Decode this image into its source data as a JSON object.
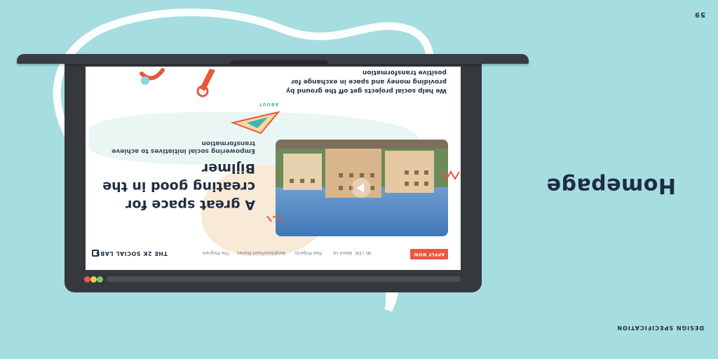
{
  "slide": {
    "page_number": "59",
    "heading": "Homepage",
    "footer_label": "DESIGN SPECIFICATION"
  },
  "site": {
    "brand": "THE 2K SOCIAL LABS",
    "nav": [
      "The Program",
      "Neighbourhood Stories",
      "Past Projects",
      "About Us",
      "NL | EN"
    ],
    "cta_label": "APPLY NOW",
    "hero_title": "A great space for creating good in the Bijlmer",
    "hero_subtitle": "Empowering social initiatives to achieve transformation",
    "about_label": "ABOUT",
    "about_text": "We help social projects get off the ground by providing money and space in exchange for positive transformation"
  },
  "colors": {
    "background": "#a6dde1",
    "accent": "#e8573e",
    "teal": "#3bb7b0",
    "navy": "#1f2c42"
  }
}
